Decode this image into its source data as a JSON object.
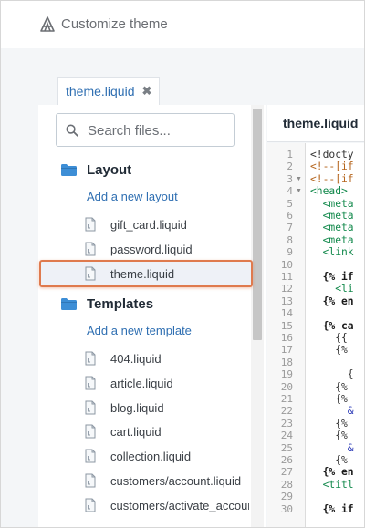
{
  "app": {
    "title": "Customize theme",
    "logo_icon": "shopify-logo-icon"
  },
  "tab": {
    "label": "theme.liquid",
    "close_glyph": "✖"
  },
  "search": {
    "placeholder": "Search files..."
  },
  "sections": [
    {
      "title": "Layout",
      "add_link": "Add a new layout",
      "files": [
        "gift_card.liquid",
        "password.liquid",
        "theme.liquid"
      ]
    },
    {
      "title": "Templates",
      "add_link": "Add a new template",
      "files": [
        "404.liquid",
        "article.liquid",
        "blog.liquid",
        "cart.liquid",
        "collection.liquid",
        "customers/account.liquid",
        "customers/activate_accour"
      ]
    }
  ],
  "selected_file": "theme.liquid",
  "editor": {
    "title": "theme.liquid",
    "line_numbers": [
      "1",
      "2",
      "3",
      "4",
      "5",
      "6",
      "7",
      "8",
      "9",
      "10",
      "11",
      "12",
      "13",
      "14",
      "15",
      "16",
      "17",
      "18",
      "19",
      "20",
      "21",
      "22",
      "23",
      "24",
      "25",
      "26",
      "27",
      "28",
      "29",
      "30"
    ],
    "lines": [
      {
        "t": "<!docty",
        "c": "plain"
      },
      {
        "t": "<!--[if",
        "c": "comment"
      },
      {
        "t": "<!--[if",
        "c": "comment"
      },
      {
        "t": "<head>",
        "c": "tag"
      },
      {
        "t": "  <meta",
        "c": "tag"
      },
      {
        "t": "  <meta",
        "c": "tag"
      },
      {
        "t": "  <meta",
        "c": "tag"
      },
      {
        "t": "  <meta",
        "c": "tag"
      },
      {
        "t": "  <link",
        "c": "tag"
      },
      {
        "t": "",
        "c": "plain"
      },
      {
        "t": "  {% if",
        "c": "kw"
      },
      {
        "t": "    <li",
        "c": "tag"
      },
      {
        "t": "  {% en",
        "c": "kw"
      },
      {
        "t": "",
        "c": "plain"
      },
      {
        "t": "  {% ca",
        "c": "kw"
      },
      {
        "t": "    {{",
        "c": "plain"
      },
      {
        "t": "    {%",
        "c": "plain"
      },
      {
        "t": "",
        "c": "plain"
      },
      {
        "t": "      {",
        "c": "plain"
      },
      {
        "t": "    {%",
        "c": "plain"
      },
      {
        "t": "    {%",
        "c": "plain"
      },
      {
        "t": "      &",
        "c": "blue"
      },
      {
        "t": "    {%",
        "c": "plain"
      },
      {
        "t": "    {%",
        "c": "plain"
      },
      {
        "t": "      &",
        "c": "blue"
      },
      {
        "t": "    {%",
        "c": "plain"
      },
      {
        "t": "  {% en",
        "c": "kw"
      },
      {
        "t": "  <titl",
        "c": "tag"
      },
      {
        "t": "",
        "c": "plain"
      },
      {
        "t": "  {% if",
        "c": "kw"
      }
    ],
    "fold_lines": [
      3,
      4
    ]
  },
  "colors": {
    "accent": "#2f6fb2",
    "highlight_border": "#df7a4e",
    "folder": "#3d8ed6"
  }
}
